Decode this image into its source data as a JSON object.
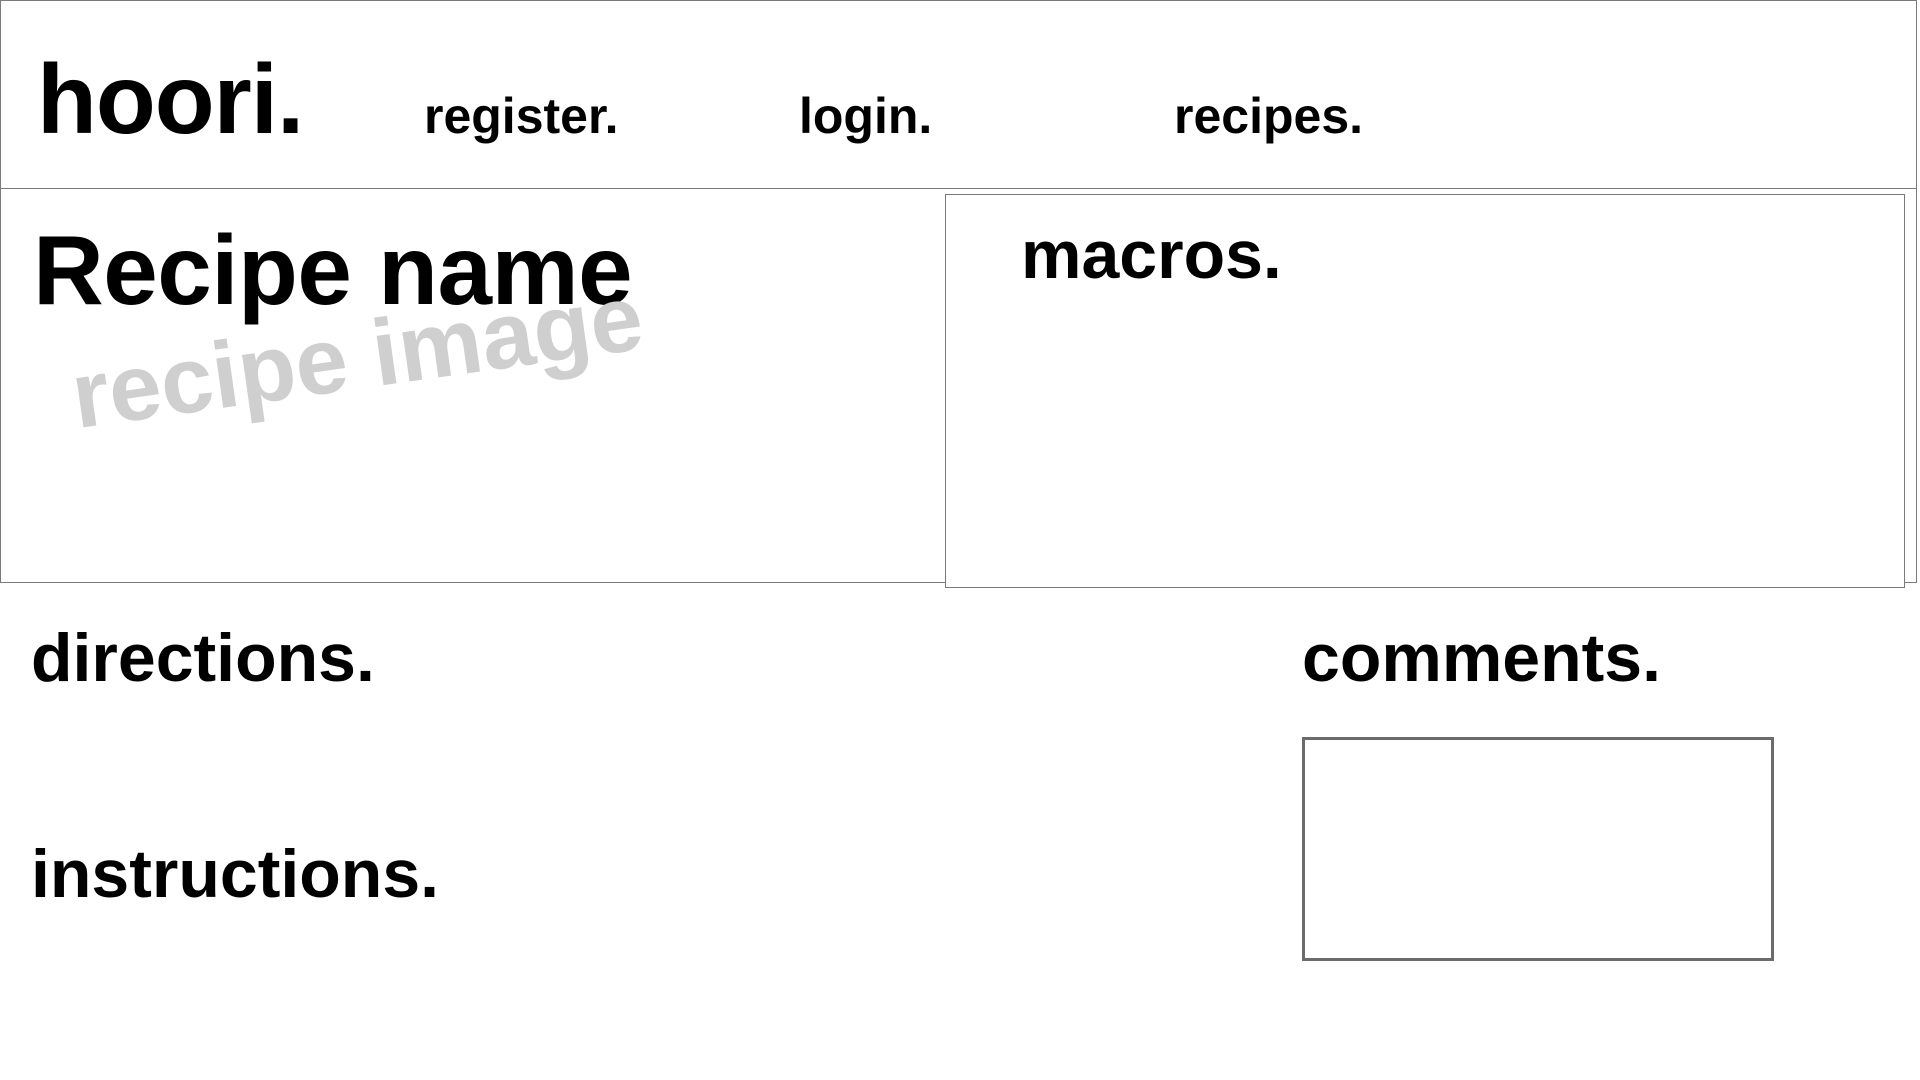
{
  "header": {
    "brand": "hoori.",
    "nav": {
      "register": "register.",
      "login": "login.",
      "recipes": "recipes."
    }
  },
  "hero": {
    "recipe_name": "Recipe name",
    "image_placeholder": "recipe image"
  },
  "macros": {
    "title": "macros."
  },
  "main": {
    "directions_title": "directions.",
    "instructions_title": "instructions."
  },
  "comments": {
    "title": "comments."
  },
  "colors": {
    "border": "#7a7a7a",
    "placeholder_text": "#cfcfcf",
    "text": "#000000"
  }
}
